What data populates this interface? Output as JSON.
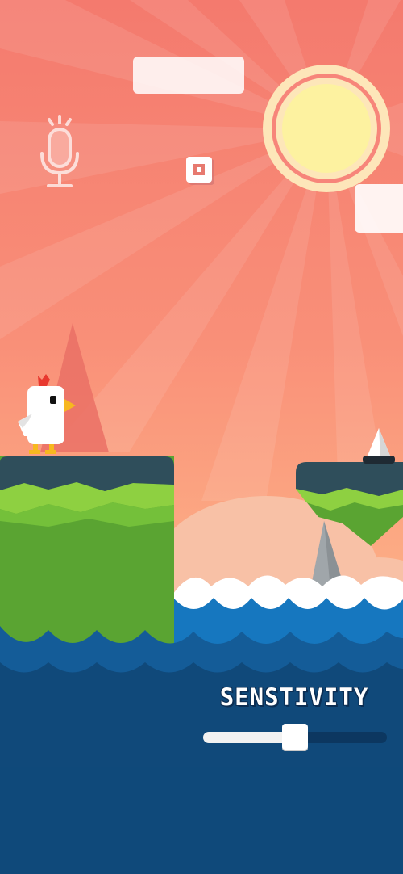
{
  "hud": {
    "mic_icon": "microphone-icon",
    "pause_icon": "pause-button-icon",
    "sensitivity_label": "SENSTIVITY"
  },
  "sensitivity": {
    "value": 0.5
  },
  "colors": {
    "sky_top": "#f47a6e",
    "sky_bottom": "#fdb286",
    "sun": "#fdf2a0",
    "sun_ring": "#fde7c0",
    "grass": "#5ca532",
    "grass_light": "#8fd13f",
    "cliff_top": "#2f4d5a",
    "sea_deep": "#10497a",
    "sea_mid": "#1678c0",
    "chicken": "#ffffff",
    "comb": "#e8382f",
    "beak": "#f7b81f"
  }
}
